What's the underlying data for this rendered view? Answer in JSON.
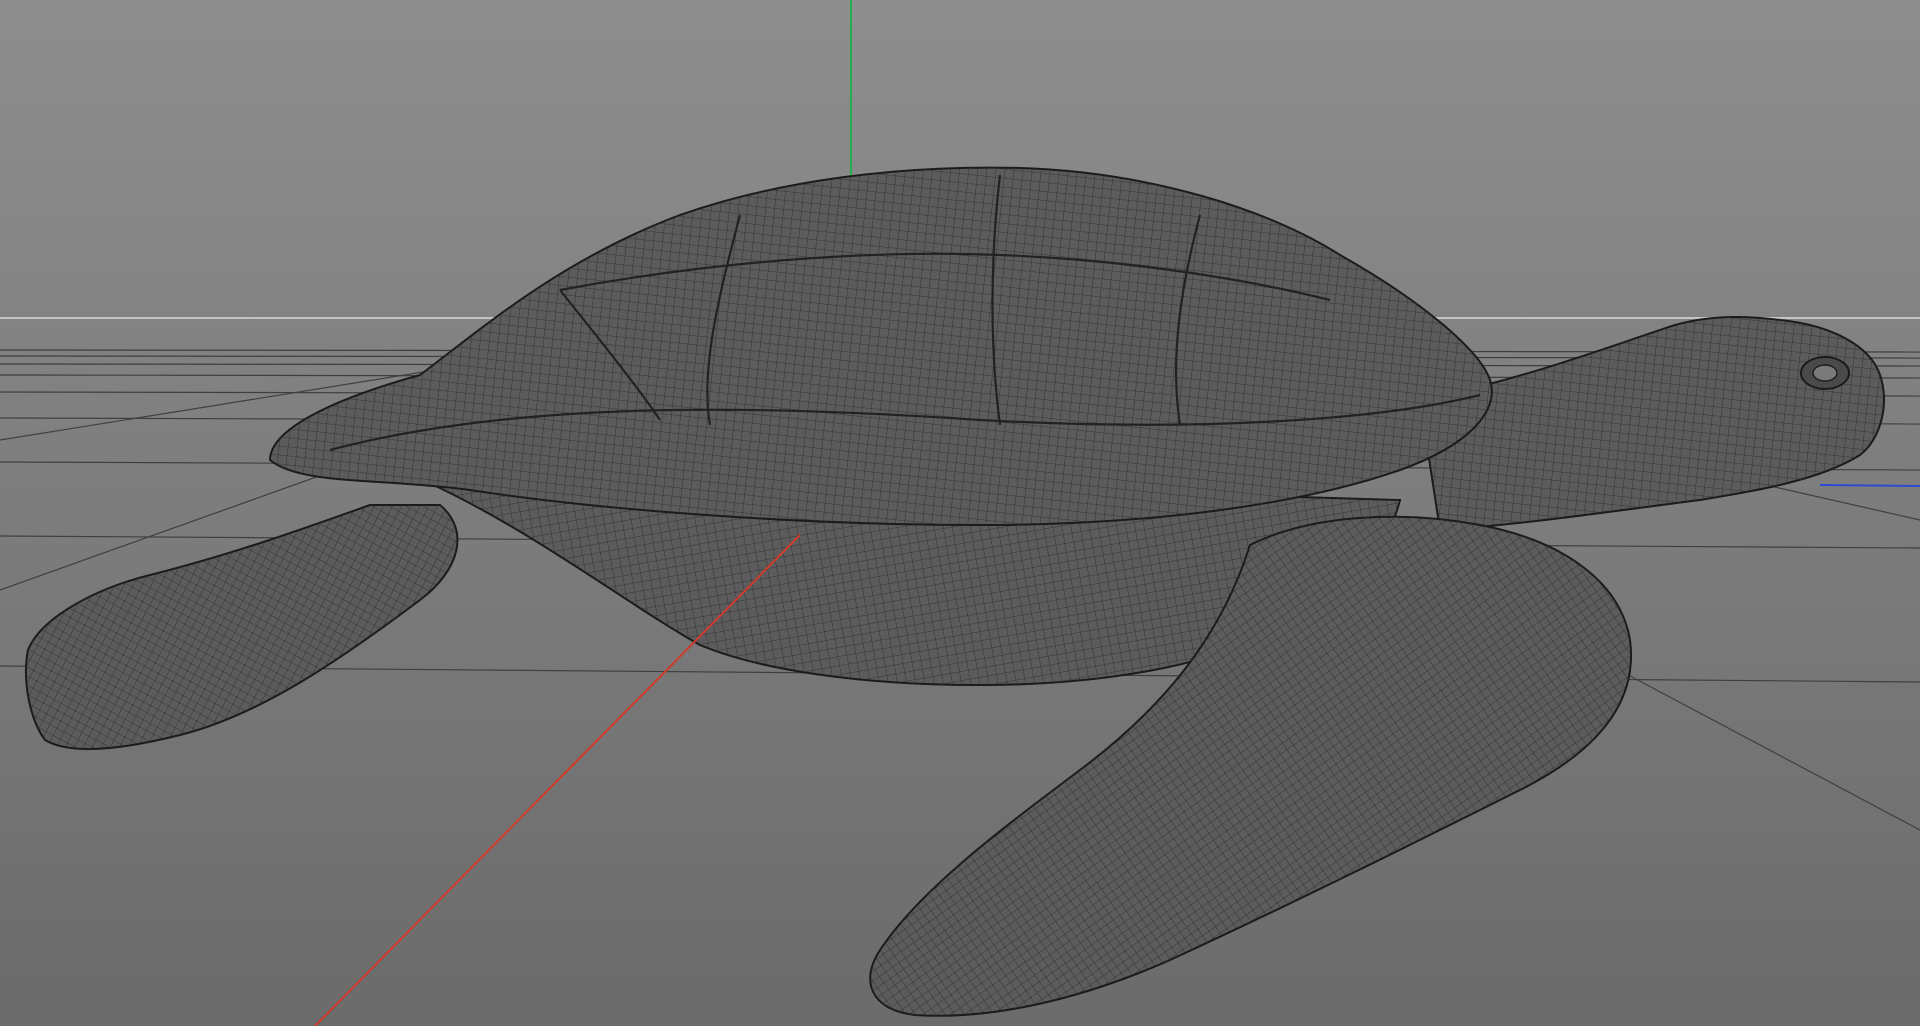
{
  "viewport": {
    "view_type": "perspective",
    "display_mode": "wireframe",
    "background_colors": {
      "top": "#8e8e8e",
      "bottom": "#6b6b6b"
    },
    "grid_color": "#3f3f3f",
    "horizon_color": "#c4c4c4",
    "axis_colors": {
      "x": "#d23a2a",
      "y": "#22b04a",
      "z": "#2a4ad2"
    },
    "mesh": {
      "object": "sea turtle",
      "fill_color": "#5c5c5c",
      "wire_color": "#2a2a2a",
      "outline_color": "#1b1b1b"
    }
  }
}
